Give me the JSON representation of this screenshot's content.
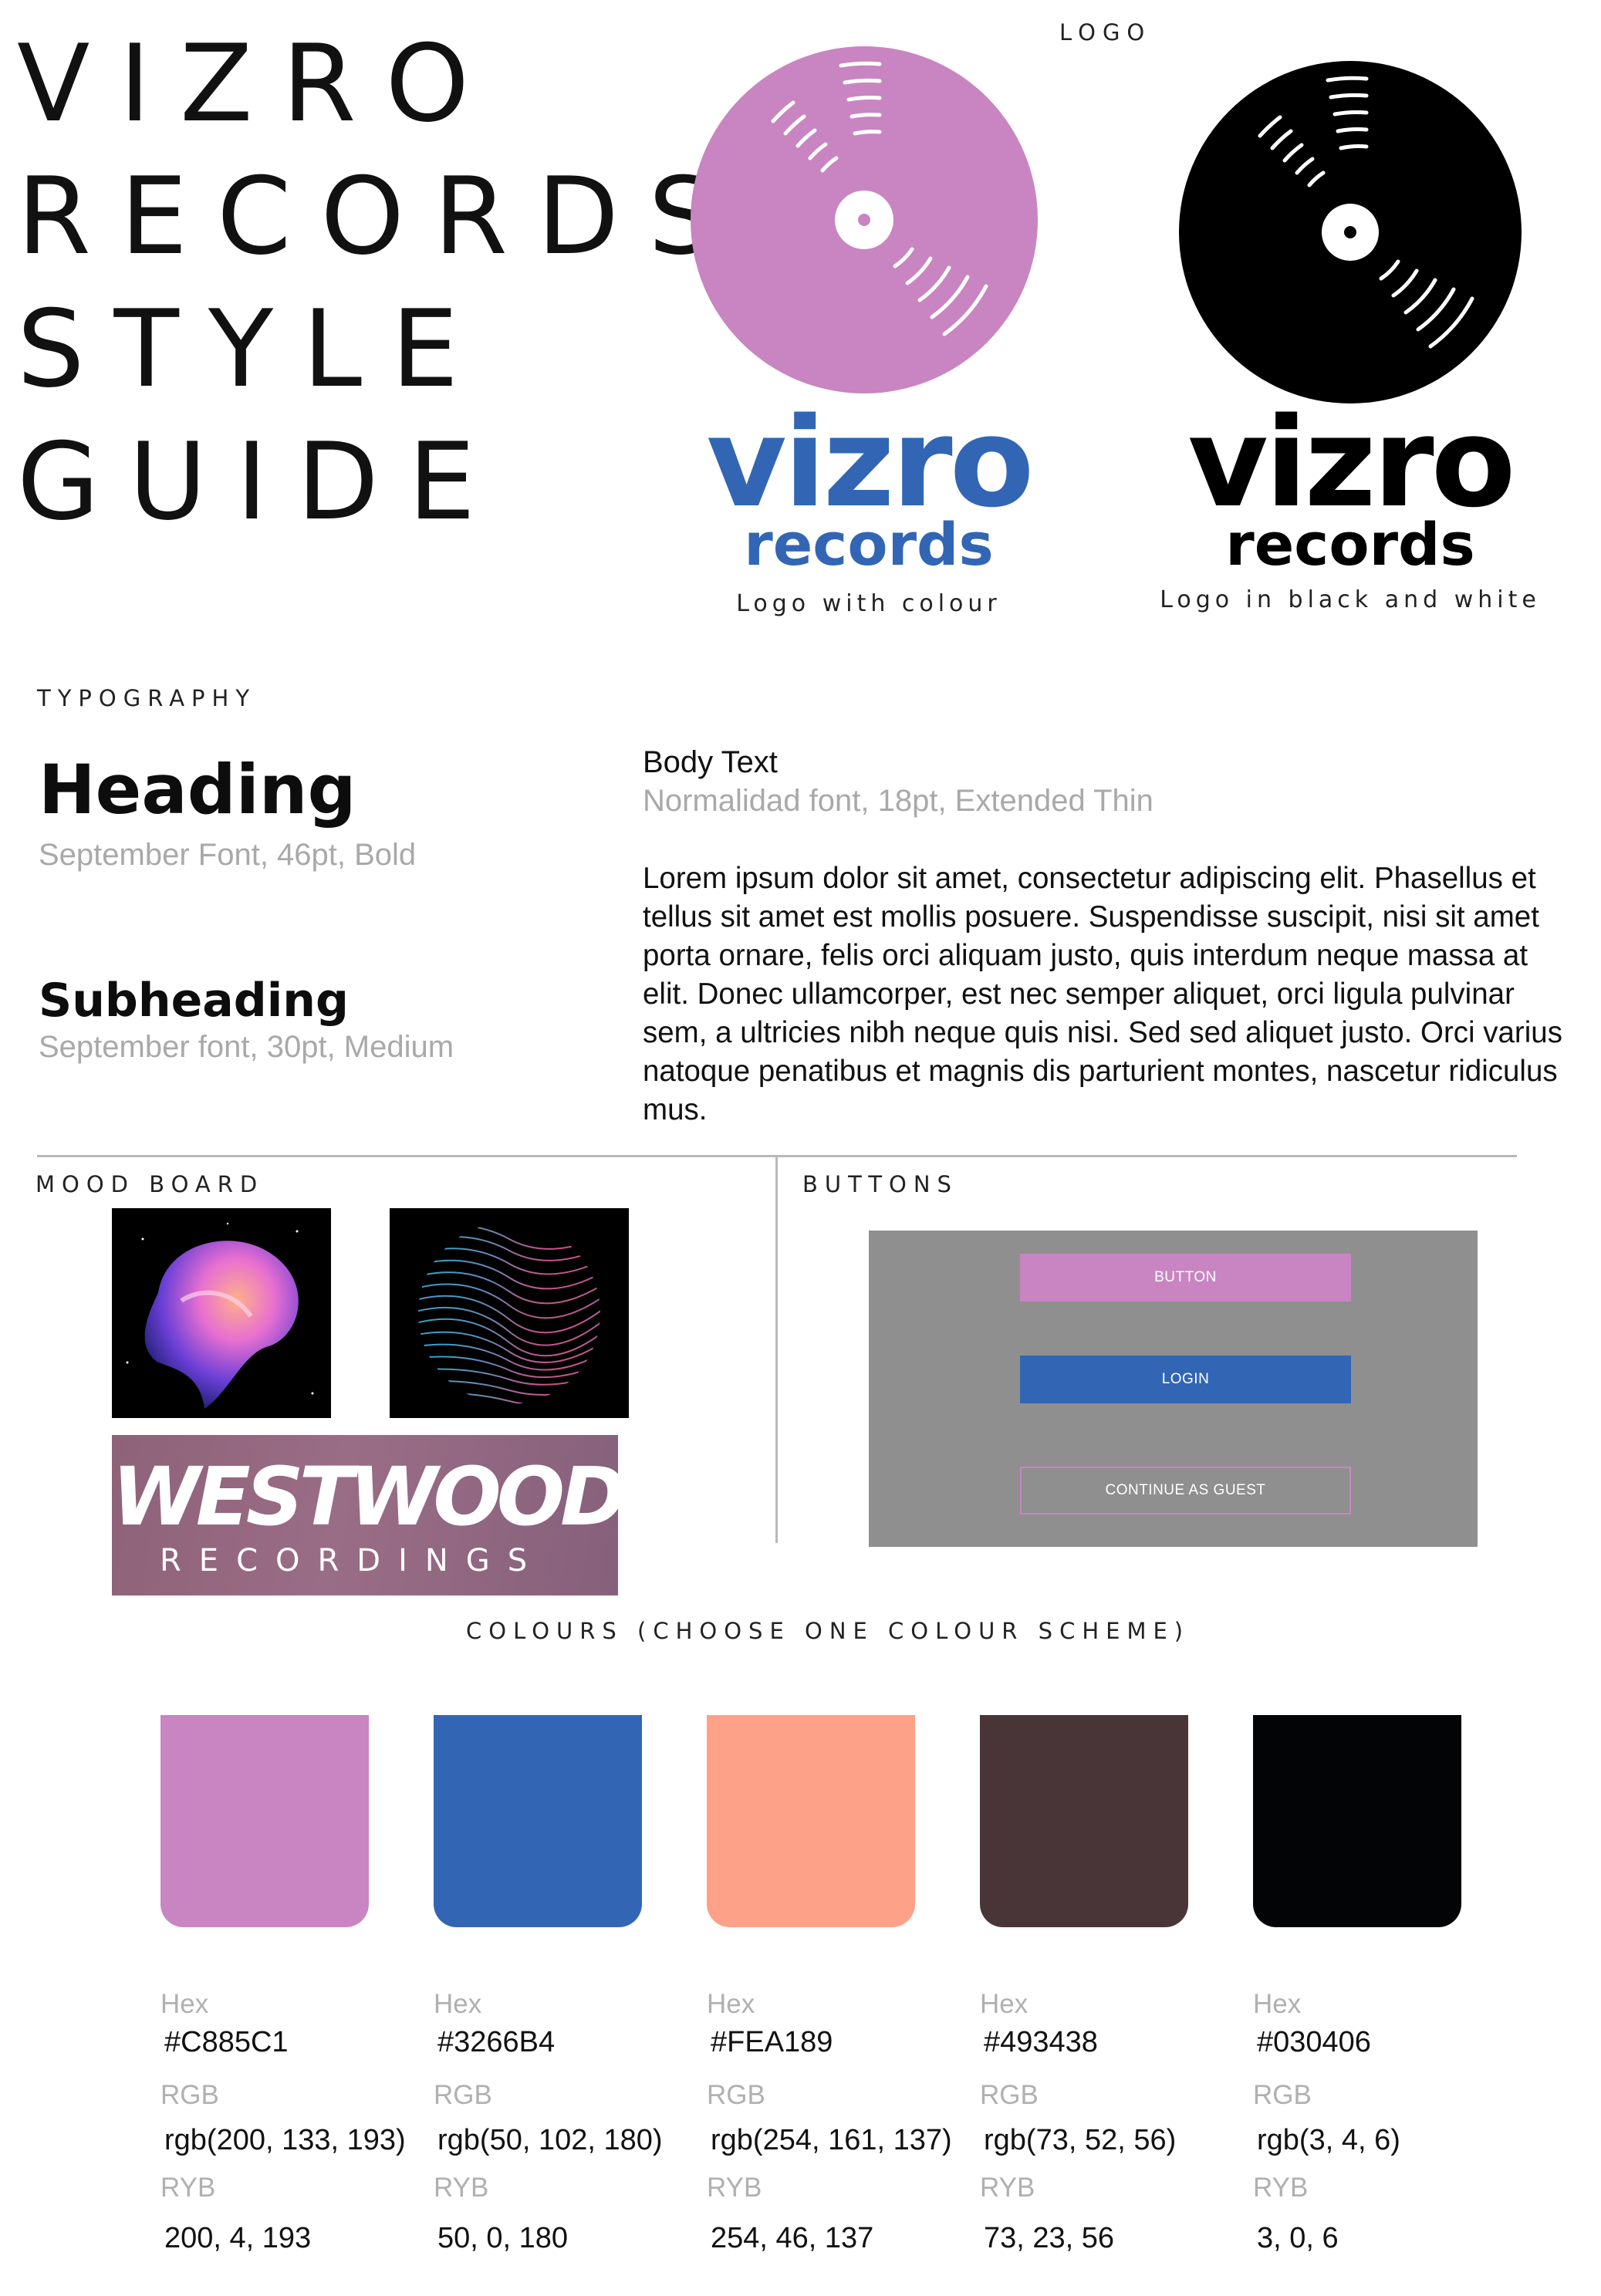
{
  "title": {
    "lines": [
      "VIZRO",
      "RECORDS",
      "STYLE",
      "GUIDE"
    ]
  },
  "logo": {
    "section_label": "LOGO",
    "colour": {
      "word": "vizro",
      "sub": "records",
      "caption": "Logo with colour",
      "disc_color": "#C885C1",
      "text_color": "#3266B4"
    },
    "bw": {
      "word": "vizro",
      "sub": "records",
      "caption": "Logo in black and white",
      "disc_color": "#000000",
      "text_color": "#000000"
    }
  },
  "typography": {
    "section_label": "TYPOGRAPHY",
    "heading": {
      "sample": "Heading",
      "spec": "September Font, 46pt, Bold"
    },
    "subheading": {
      "sample": "Subheading",
      "spec": "September font, 30pt, Medium"
    },
    "body": {
      "title": "Body Text",
      "spec": "Normalidad font, 18pt, Extended Thin",
      "lorem": "Lorem ipsum dolor sit amet, consectetur adipiscing elit. Phasellus et tellus sit amet est mollis posuere. Suspendisse suscipit, nisi sit amet porta ornare, felis orci aliquam justo, quis interdum neque massa at elit. Donec ullamcorper, est nec semper aliquet, orci ligula pulvinar sem, a ultricies nibh neque quis nisi. Sed sed aliquet justo. Orci varius natoque penatibus et magnis dis parturient montes, nascetur ridiculus mus."
    }
  },
  "mood_board": {
    "section_label": "MOOD BOARD",
    "westwood": {
      "word": "WESTWOOD",
      "sub": "RECORDINGS"
    }
  },
  "buttons": {
    "section_label": "BUTTONS",
    "items": [
      {
        "label": "BUTTON",
        "style": "filled",
        "color": "#C885C1"
      },
      {
        "label": "LOGIN",
        "style": "filled",
        "color": "#3266B4"
      },
      {
        "label": "CONTINUE AS GUEST",
        "style": "outline",
        "color": "#C885C1"
      }
    ]
  },
  "colours": {
    "section_label": "COLOURS (CHOOSE ONE COLOUR SCHEME)",
    "hex_label": "Hex",
    "rgb_label": "RGB",
    "ryb_label": "RYB",
    "items": [
      {
        "hex": "#C885C1",
        "rgb": "rgb(200, 133, 193)",
        "ryb": "200, 4, 193",
        "swatch": "#C885C1"
      },
      {
        "hex": "#3266B4",
        "rgb": "rgb(50, 102, 180)",
        "ryb": "50, 0, 180",
        "swatch": "#3266B4"
      },
      {
        "hex": "#FEA189",
        "rgb": "rgb(254, 161, 137)",
        "ryb": "254, 46, 137",
        "swatch": "#FEA189"
      },
      {
        "hex": "#493438",
        "rgb": "rgb(73, 52, 56)",
        "ryb": "73, 23, 56",
        "swatch": "#493438"
      },
      {
        "hex": "#030406",
        "rgb": "rgb(3, 4, 6)",
        "ryb": "3, 0, 6",
        "swatch": "#030406"
      }
    ]
  }
}
